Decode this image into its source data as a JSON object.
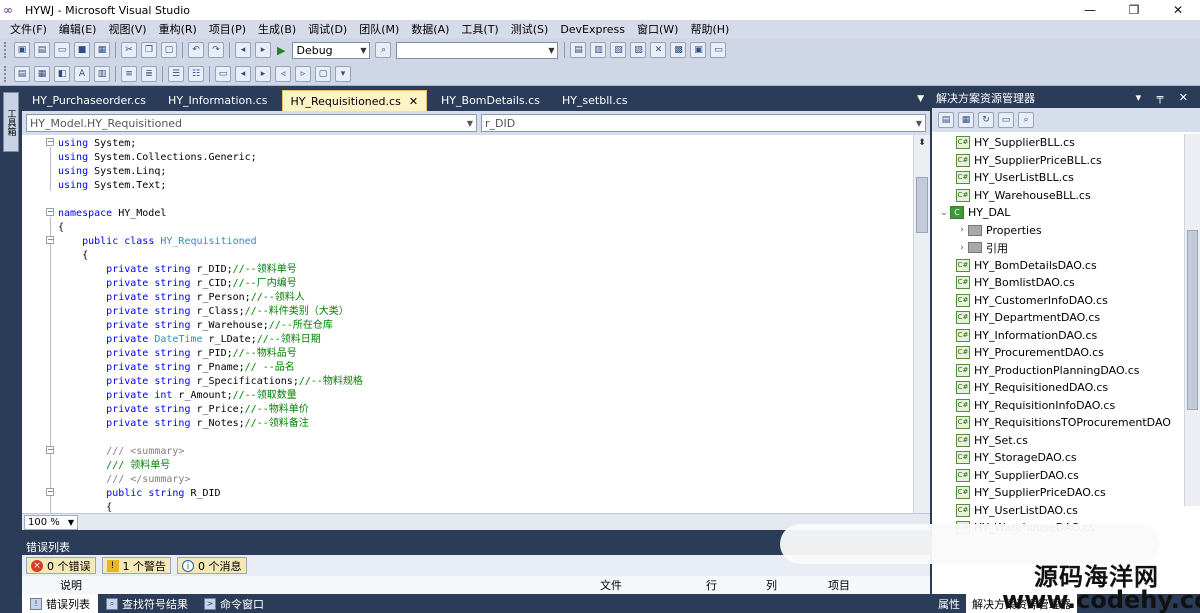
{
  "window": {
    "title": "HYWJ - Microsoft Visual Studio",
    "controls": [
      "—",
      "❐",
      "✕"
    ]
  },
  "menu": [
    "文件(F)",
    "编辑(E)",
    "视图(V)",
    "重构(R)",
    "项目(P)",
    "生成(B)",
    "调试(D)",
    "团队(M)",
    "数据(A)",
    "工具(T)",
    "测试(S)",
    "DevExpress",
    "窗口(W)",
    "帮助(H)"
  ],
  "toolbar": {
    "config": "Debug",
    "platform": ""
  },
  "left_strip": {
    "label": "工具箱"
  },
  "tabs": [
    {
      "label": "HY_Purchaseorder.cs",
      "active": false
    },
    {
      "label": "HY_Information.cs",
      "active": false
    },
    {
      "label": "HY_Requisitioned.cs",
      "active": true
    },
    {
      "label": "HY_BomDetails.cs",
      "active": false
    },
    {
      "label": "HY_setbll.cs",
      "active": false
    }
  ],
  "navbar": {
    "type_combo": "HY_Model.HY_Requisitioned",
    "member_combo": "r_DID"
  },
  "code": {
    "lines": [
      [
        [
          "kw",
          "using"
        ],
        [
          "t",
          " System;"
        ]
      ],
      [
        [
          "kw",
          "using"
        ],
        [
          "t",
          " System.Collections.Generic;"
        ]
      ],
      [
        [
          "kw",
          "using"
        ],
        [
          "t",
          " System.Linq;"
        ]
      ],
      [
        [
          "kw",
          "using"
        ],
        [
          "t",
          " System.Text;"
        ]
      ],
      [],
      [
        [
          "kw",
          "namespace"
        ],
        [
          "t",
          " HY_Model"
        ]
      ],
      [
        [
          "t",
          "{"
        ]
      ],
      [
        [
          "t",
          "    "
        ],
        [
          "kw",
          "public class"
        ],
        [
          "t",
          " "
        ],
        [
          "ty",
          "HY_Requisitioned"
        ]
      ],
      [
        [
          "t",
          "    {"
        ]
      ],
      [
        [
          "t",
          "        "
        ],
        [
          "kw",
          "private string"
        ],
        [
          "t",
          " r_DID;"
        ],
        [
          "cm",
          "//--领料单号"
        ]
      ],
      [
        [
          "t",
          "        "
        ],
        [
          "kw",
          "private string"
        ],
        [
          "t",
          " r_CID;"
        ],
        [
          "cm",
          "//--厂内编号"
        ]
      ],
      [
        [
          "t",
          "        "
        ],
        [
          "kw",
          "private string"
        ],
        [
          "t",
          " r_Person;"
        ],
        [
          "cm",
          "//--领料人"
        ]
      ],
      [
        [
          "t",
          "        "
        ],
        [
          "kw",
          "private string"
        ],
        [
          "t",
          " r_Class;"
        ],
        [
          "cm",
          "//--料件类别（大类）"
        ]
      ],
      [
        [
          "t",
          "        "
        ],
        [
          "kw",
          "private string"
        ],
        [
          "t",
          " r_Warehouse;"
        ],
        [
          "cm",
          "//--所在仓库"
        ]
      ],
      [
        [
          "t",
          "        "
        ],
        [
          "kw",
          "private"
        ],
        [
          "t",
          " "
        ],
        [
          "ty",
          "DateTime"
        ],
        [
          "t",
          " r_LDate;"
        ],
        [
          "cm",
          "//--领料日期"
        ]
      ],
      [
        [
          "t",
          "        "
        ],
        [
          "kw",
          "private string"
        ],
        [
          "t",
          " r_PID;"
        ],
        [
          "cm",
          "//--物料品号"
        ]
      ],
      [
        [
          "t",
          "        "
        ],
        [
          "kw",
          "private string"
        ],
        [
          "t",
          " r_Pname;"
        ],
        [
          "cm",
          "// --品名"
        ]
      ],
      [
        [
          "t",
          "        "
        ],
        [
          "kw",
          "private string"
        ],
        [
          "t",
          " r_Specifications;"
        ],
        [
          "cm",
          "//--物料规格"
        ]
      ],
      [
        [
          "t",
          "        "
        ],
        [
          "kw",
          "private int"
        ],
        [
          "t",
          " r_Amount;"
        ],
        [
          "cm",
          "//--领取数量"
        ]
      ],
      [
        [
          "t",
          "        "
        ],
        [
          "kw",
          "private string"
        ],
        [
          "t",
          " r_Price;"
        ],
        [
          "cm",
          "//--物料单价"
        ]
      ],
      [
        [
          "t",
          "        "
        ],
        [
          "kw",
          "private string"
        ],
        [
          "t",
          " r_Notes;"
        ],
        [
          "cm",
          "//--领料备注"
        ]
      ],
      [],
      [
        [
          "t",
          "        "
        ],
        [
          "dc",
          "/// <summary>"
        ]
      ],
      [
        [
          "t",
          "        "
        ],
        [
          "cm",
          "/// 领料单号"
        ]
      ],
      [
        [
          "t",
          "        "
        ],
        [
          "dc",
          "/// </summary>"
        ]
      ],
      [
        [
          "t",
          "        "
        ],
        [
          "kw",
          "public string"
        ],
        [
          "t",
          " R_DID"
        ]
      ],
      [
        [
          "t",
          "        {"
        ]
      ]
    ]
  },
  "zoom": "100 %",
  "error_list": {
    "title": "错误列表",
    "errors": "0 个错误",
    "warnings": "1 个警告",
    "messages": "0 个消息",
    "columns": {
      "desc": "说明",
      "file": "文件",
      "line": "行",
      "col": "列",
      "project": "项目"
    }
  },
  "bottom_tabs": [
    "错误列表",
    "查找符号结果",
    "命令窗口"
  ],
  "solution_explorer": {
    "title": "解决方案资源管理器",
    "header_buttons": "▾ ╤ ✕",
    "items": [
      {
        "label": "HY_SupplierBLL.cs",
        "kind": "file",
        "level": 2
      },
      {
        "label": "HY_SupplierPriceBLL.cs",
        "kind": "file",
        "level": 2
      },
      {
        "label": "HY_UserListBLL.cs",
        "kind": "file",
        "level": 2
      },
      {
        "label": "HY_WarehouseBLL.cs",
        "kind": "file",
        "level": 2
      },
      {
        "label": "HY_DAL",
        "kind": "project",
        "level": 1,
        "expander": "⌄"
      },
      {
        "label": "Properties",
        "kind": "folder",
        "level": 2,
        "expander": "›"
      },
      {
        "label": "引用",
        "kind": "folder",
        "level": 2,
        "expander": "›"
      },
      {
        "label": "HY_BomDetailsDAO.cs",
        "kind": "file",
        "level": 2
      },
      {
        "label": "HY_BomlistDAO.cs",
        "kind": "file",
        "level": 2
      },
      {
        "label": "HY_CustomerInfoDAO.cs",
        "kind": "file",
        "level": 2
      },
      {
        "label": "HY_DepartmentDAO.cs",
        "kind": "file",
        "level": 2
      },
      {
        "label": "HY_InformationDAO.cs",
        "kind": "file",
        "level": 2
      },
      {
        "label": "HY_ProcurementDAO.cs",
        "kind": "file",
        "level": 2
      },
      {
        "label": "HY_ProductionPlanningDAO.cs",
        "kind": "file",
        "level": 2
      },
      {
        "label": "HY_RequisitionedDAO.cs",
        "kind": "file",
        "level": 2
      },
      {
        "label": "HY_RequisitionInfoDAO.cs",
        "kind": "file",
        "level": 2
      },
      {
        "label": "HY_RequisitionsTOProcurementDAO",
        "kind": "file",
        "level": 2
      },
      {
        "label": "HY_Set.cs",
        "kind": "file",
        "level": 2
      },
      {
        "label": "HY_StorageDAO.cs",
        "kind": "file",
        "level": 2
      },
      {
        "label": "HY_SupplierDAO.cs",
        "kind": "file",
        "level": 2
      },
      {
        "label": "HY_SupplierPriceDAO.cs",
        "kind": "file",
        "level": 2
      },
      {
        "label": "HY_UserListDAO.cs",
        "kind": "file",
        "level": 2
      },
      {
        "label": "HY_WarehouseDAO.cs",
        "kind": "file",
        "level": 2
      }
    ],
    "bottom_tabs": [
      "属性",
      "解决方案资源管理器"
    ]
  },
  "watermark": {
    "line1": "源码海洋网",
    "line2": "www.codehy.com"
  }
}
